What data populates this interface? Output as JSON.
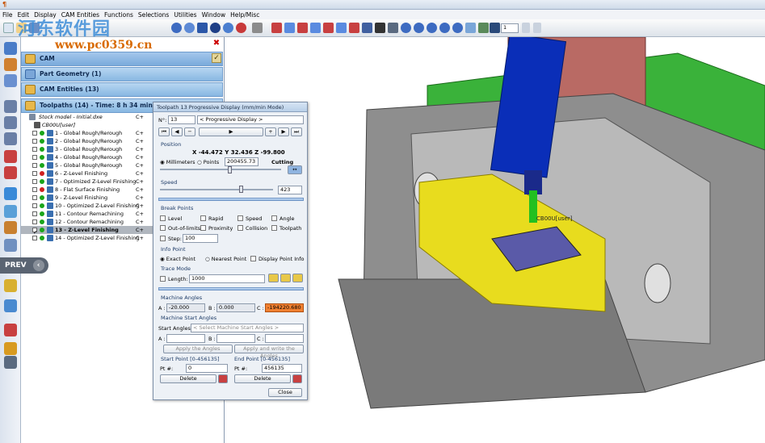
{
  "menu": [
    "File",
    "Edit",
    "Display",
    "CAM Entities",
    "Functions",
    "Selections",
    "Utilities",
    "Window",
    "Help/Misc"
  ],
  "toolbar": {
    "counter": "1"
  },
  "watermark": {
    "line1": "河东软件园",
    "line2": "www.pc0359.cn"
  },
  "prev_label": "PREV",
  "panel": {
    "hdr_cam": "CAM",
    "hdr_part": "Part Geometry (1)",
    "hdr_entities": "CAM Entities (13)",
    "hdr_toolpaths": "Toolpaths (14) - Time: 8 h 34 min",
    "stock": "Stock model - Initial.dxe",
    "stock_cc": "C+",
    "user": "CB00U[user]",
    "rows": [
      {
        "label": "1 - Global Rough/Rerough",
        "cc": "C+",
        "dot": "#1aa51a"
      },
      {
        "label": "2 - Global Rough/Rerough",
        "cc": "C+",
        "dot": "#1aa51a"
      },
      {
        "label": "3 - Global Rough/Rerough",
        "cc": "C+",
        "dot": "#1aa51a"
      },
      {
        "label": "4 - Global Rough/Rerough",
        "cc": "C+",
        "dot": "#1aa51a"
      },
      {
        "label": "5 - Global Rough/Rerough",
        "cc": "C+",
        "dot": "#1aa51a"
      },
      {
        "label": "6 - Z-Level Finishing",
        "cc": "C+",
        "dot": "#d02020"
      },
      {
        "label": "7 - Optimized Z-Level Finishing",
        "cc": "C+",
        "dot": "#1aa51a"
      },
      {
        "label": "8 - Flat Surface Finishing",
        "cc": "C+",
        "dot": "#d02020"
      },
      {
        "label": "9 - Z-Level Finishing",
        "cc": "C+",
        "dot": "#1aa51a"
      },
      {
        "label": "10 - Optimized Z-Level Finishing",
        "cc": "C+",
        "dot": "#1aa51a"
      },
      {
        "label": "11 - Contour Remachining",
        "cc": "C+",
        "dot": "#1aa51a"
      },
      {
        "label": "12 - Contour Remachining",
        "cc": "C+",
        "dot": "#1aa51a"
      },
      {
        "label": "13 - Z-Level Finishing",
        "cc": "C+",
        "dot": "#1aa51a"
      },
      {
        "label": "14 - Optimized Z-Level Finishing",
        "cc": "C+",
        "dot": "#1aa51a"
      }
    ]
  },
  "dialog": {
    "title": "Toolpath 13 Progressive Display (mm/min Mode)",
    "n_label": "N°:",
    "n_value": "13",
    "mode": "< Progressive Display >",
    "position": "Position",
    "coords": "X -44.472 Y 32.436 Z -99.800",
    "millimeters": "Millimeters",
    "points": "Points",
    "points_value": "200455.73",
    "cutting": "Cutting",
    "speed": "Speed",
    "speed_value": "423",
    "break_points": "Break Points",
    "bp": [
      "Level",
      "Rapid",
      "Speed",
      "Angle",
      "Out-of-limits",
      "Proximity",
      "Collision",
      "Toolpath"
    ],
    "step": "Step:",
    "step_value": "100",
    "info_point": "Info Point",
    "exact": "Exact Point",
    "nearest": "Nearest Point",
    "display_info": "Display Point Info",
    "trace_mode": "Trace Mode",
    "length": "Length:",
    "length_value": "1000",
    "machine_angles": "Machine Angles",
    "a_label": "A :",
    "a_value": "-20.000",
    "b_label": "B :",
    "b_value": "0.000",
    "c_label": "C :",
    "c_value": "-194220.680",
    "start_angles": "Machine Start Angles",
    "start_angles_label": "Start Angles:",
    "start_select": "< Select Machine Start Angles >",
    "a2": "A :",
    "b2": "B :",
    "c2": "C :",
    "apply": "Apply the Angles",
    "apply_write": "Apply and write the Angles",
    "start_point": "Start Point [0-456135]",
    "end_point": "End Point [0-456135]",
    "pt": "Pt #:",
    "start_value": "0",
    "end_value": "456135",
    "delete": "Delete",
    "close": "Close"
  },
  "viewport": {
    "tool_label": "CB00U[user]"
  },
  "colors": {
    "machine_green": "#3ab23a",
    "spindle_blue": "#0a2eb8",
    "table_yellow": "#e8dc1e",
    "body_gray": "#8e8e8e",
    "tool_green": "#22c020"
  }
}
